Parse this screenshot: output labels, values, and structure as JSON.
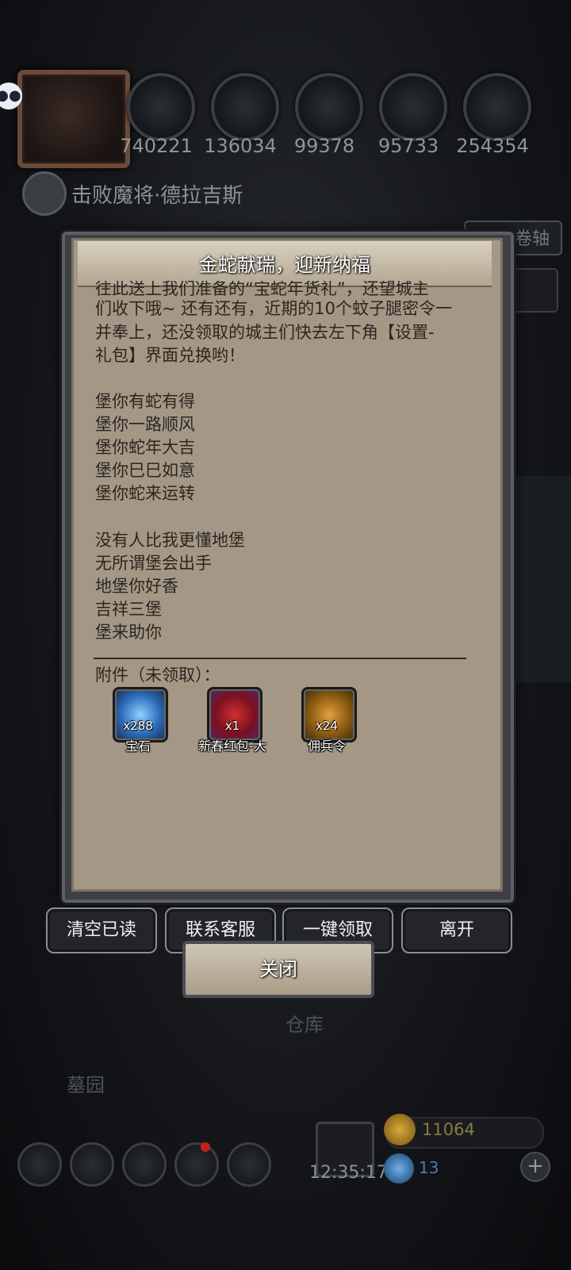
{
  "resources": [
    {
      "icon": "meat-icon",
      "value": "740221"
    },
    {
      "icon": "wood-icon",
      "value": "136034"
    },
    {
      "icon": "stone-icon",
      "value": "99378"
    },
    {
      "icon": "crystal-icon",
      "value": "95733"
    },
    {
      "icon": "iron-icon",
      "value": "254354"
    }
  ],
  "quest": {
    "text": "击败魔将·德拉吉斯"
  },
  "side": {
    "scroll_label": "卷轴"
  },
  "modal": {
    "title": "金蛇献瑞，迎新纳福",
    "lines": [
      "往此送上我们准备的“宝蛇年货礼”，还望城主",
      "们收下哦~ 还有还有，近期的10个蚊子腿密令一",
      "并奉上，还没领取的城主们快去左下角【设置-",
      "礼包】界面兑换哟！",
      "",
      "堡你有蛇有得",
      "堡你一路顺风",
      "堡你蛇年大吉",
      "堡你巳巳如意",
      "堡你蛇来运转",
      "",
      "没有人比我更懂地堡",
      "无所谓堡会出手",
      "地堡你好香",
      "吉祥三堡",
      "堡来助你"
    ],
    "attachments_label": "附件（未领取）：",
    "attachments": [
      {
        "name": "宝石",
        "count": "x288",
        "icon": "gem-item-icon"
      },
      {
        "name": "新春红包-大",
        "count": "x1",
        "icon": "red-envelope-icon"
      },
      {
        "name": "佣兵令",
        "count": "x24",
        "icon": "mercenary-token-icon"
      }
    ]
  },
  "buttons": {
    "clear_read": "清空已读",
    "contact_support": "联系客服",
    "claim_all": "一键领取",
    "leave": "离开",
    "close": "关闭"
  },
  "background": {
    "warehouse": "仓库",
    "cemetery": "墓园"
  },
  "bottom": {
    "clock": "12:35:17",
    "gold": "11064",
    "gems": "13",
    "plus": "+"
  },
  "colors": {
    "paper": "#a49785",
    "title_bar": "#c5bba8",
    "button_bg": "#232528"
  }
}
